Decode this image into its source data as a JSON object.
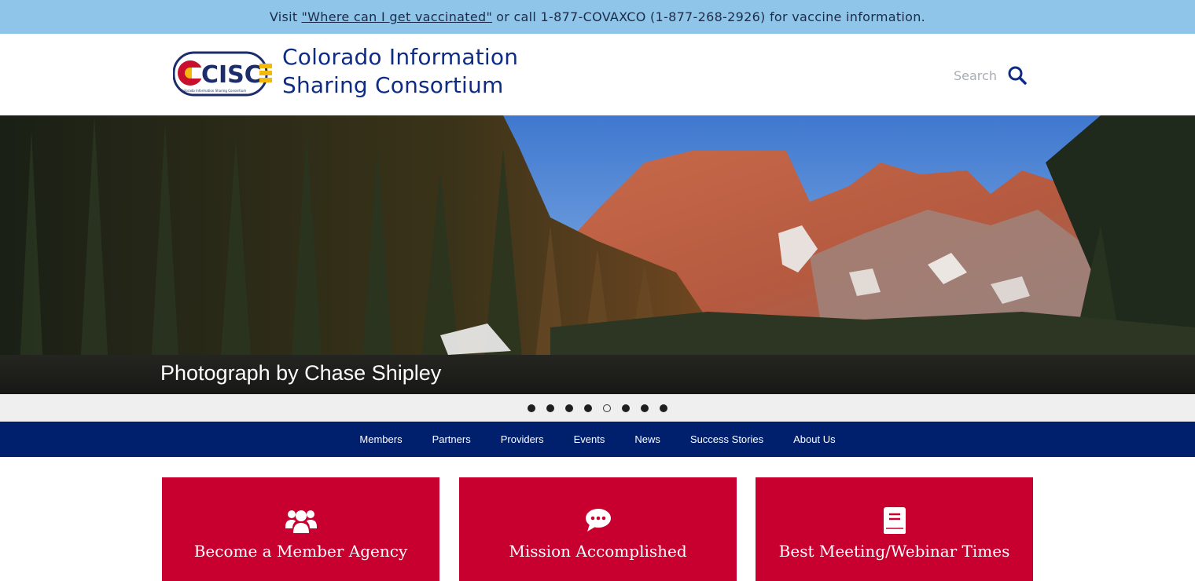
{
  "banner": {
    "prefix": "Visit",
    "link_text": "\"Where can I get vaccinated\"",
    "suffix": "or call 1-877-COVAXCO (1-877-268-2926) for vaccine information."
  },
  "header": {
    "logo_text": "CISC",
    "logo_subtext": "Colorado Information Sharing Consortium",
    "title_line1": "Colorado Information",
    "title_line2": "Sharing Consortium",
    "search_placeholder": "Search",
    "search_icon": "magnifier"
  },
  "hero": {
    "caption": "Photograph by Chase Shipley"
  },
  "carousel": {
    "dots": [
      "slide-1",
      "slide-2",
      "slide-3",
      "slide-4",
      "slide-5",
      "slide-6",
      "slide-7",
      "slide-8"
    ],
    "active_index": 4
  },
  "nav": {
    "items": [
      "Members",
      "Partners",
      "Providers",
      "Events",
      "News",
      "Success Stories",
      "About Us"
    ]
  },
  "cards": [
    {
      "label": "Become a Member Agency",
      "icon": "users-icon"
    },
    {
      "label": "Mission Accomplished",
      "icon": "chat-bubble-icon"
    },
    {
      "label": "Best Meeting/Webinar Times",
      "icon": "book-icon"
    }
  ],
  "colors": {
    "banner_bg": "#8ec5e8",
    "brand_navy": "#00206d",
    "title_blue": "#0e2b86",
    "card_red": "#c8002f"
  }
}
